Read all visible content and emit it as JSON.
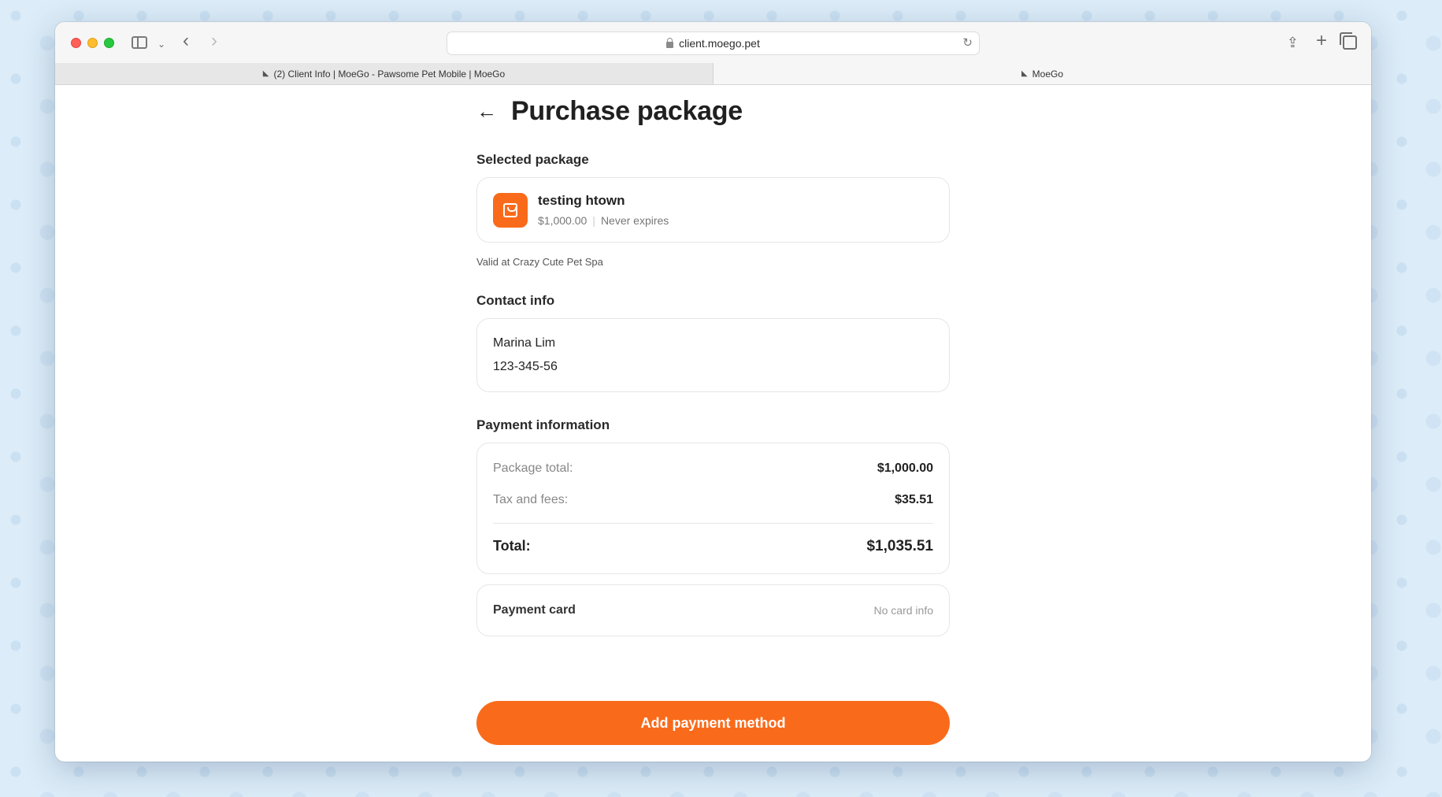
{
  "browser": {
    "url": "client.moego.pet",
    "tabs": [
      {
        "label": "(2) Client Info | MoeGo - Pawsome Pet Mobile | MoeGo"
      },
      {
        "label": "MoeGo"
      }
    ]
  },
  "page": {
    "title": "Purchase package"
  },
  "selected_package": {
    "section_title": "Selected package",
    "name": "testing htown",
    "price": "$1,000.00",
    "separator": "|",
    "expiry": "Never expires",
    "valid_text": "Valid at Crazy Cute Pet Spa"
  },
  "contact": {
    "section_title": "Contact info",
    "name": "Marina Lim",
    "phone": "123-345-56"
  },
  "payment": {
    "section_title": "Payment information",
    "package_total_label": "Package total:",
    "package_total_value": "$1,000.00",
    "tax_label": "Tax and fees:",
    "tax_value": "$35.51",
    "total_label": "Total:",
    "total_value": "$1,035.51",
    "card_label": "Payment card",
    "card_info": "No card info"
  },
  "actions": {
    "add_payment_label": "Add payment method"
  },
  "colors": {
    "accent": "#f96b1b"
  }
}
